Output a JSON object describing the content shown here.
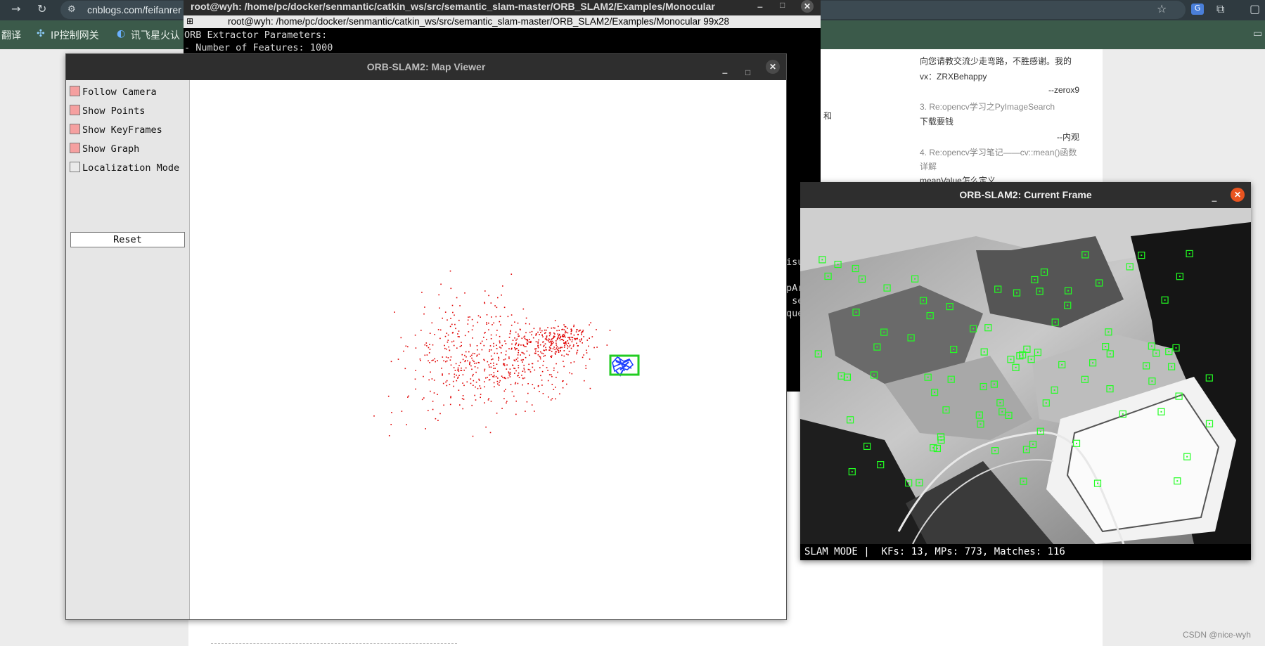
{
  "browser": {
    "url": "cnblogs.com/feifanrer",
    "bookmarks": [
      "翻译",
      "IP控制网关",
      "讯飞星火认"
    ]
  },
  "blog": {
    "lines": [
      "向您请教交流少走弯路，不胜感谢。我的",
      "vx：ZRXBehappy",
      "--zerox9",
      "3. Re:opencv学习之PyImageSearch",
      "下载要钱",
      "--内观",
      "4. Re:opencv学习笔记——cv::mean()函数",
      "详解",
      "meanValue怎么定义"
    ],
    "fragment_he": "和",
    "watermark": "CSDN @nice-wyh"
  },
  "terminal": {
    "title": "root@wyh: /home/pc/docker/senmantic/catkin_ws/src/semantic_slam-master/ORB_SLAM2/Examples/Monocular",
    "subtitle": "root@wyh: /home/pc/docker/senmantic/catkin_ws/src/semantic_slam-master/ORB_SLAM2/Examples/Monocular 99x28",
    "lines": [
      "ORB Extractor Parameters:",
      "- Number of Features: 1000"
    ],
    "fragments": [
      "isu",
      "pAr",
      " se",
      "que"
    ]
  },
  "map_viewer": {
    "title": "ORB-SLAM2: Map Viewer",
    "options": [
      {
        "label": "Follow Camera",
        "checked": true
      },
      {
        "label": "Show Points",
        "checked": true
      },
      {
        "label": "Show KeyFrames",
        "checked": true
      },
      {
        "label": "Show Graph",
        "checked": true
      },
      {
        "label": "Localization Mode",
        "checked": false
      }
    ],
    "reset_label": "Reset"
  },
  "current_frame": {
    "title": "ORB-SLAM2: Current Frame",
    "status": "SLAM MODE |  KFs: 13, MPs: 773, Matches: 116"
  },
  "colors": {
    "map_point": "#e00000",
    "keyframe": "#1a3cff",
    "current_camera": "#22cc22",
    "feature_box": "#22ff22",
    "close_button_ubuntu": "#e95420"
  }
}
